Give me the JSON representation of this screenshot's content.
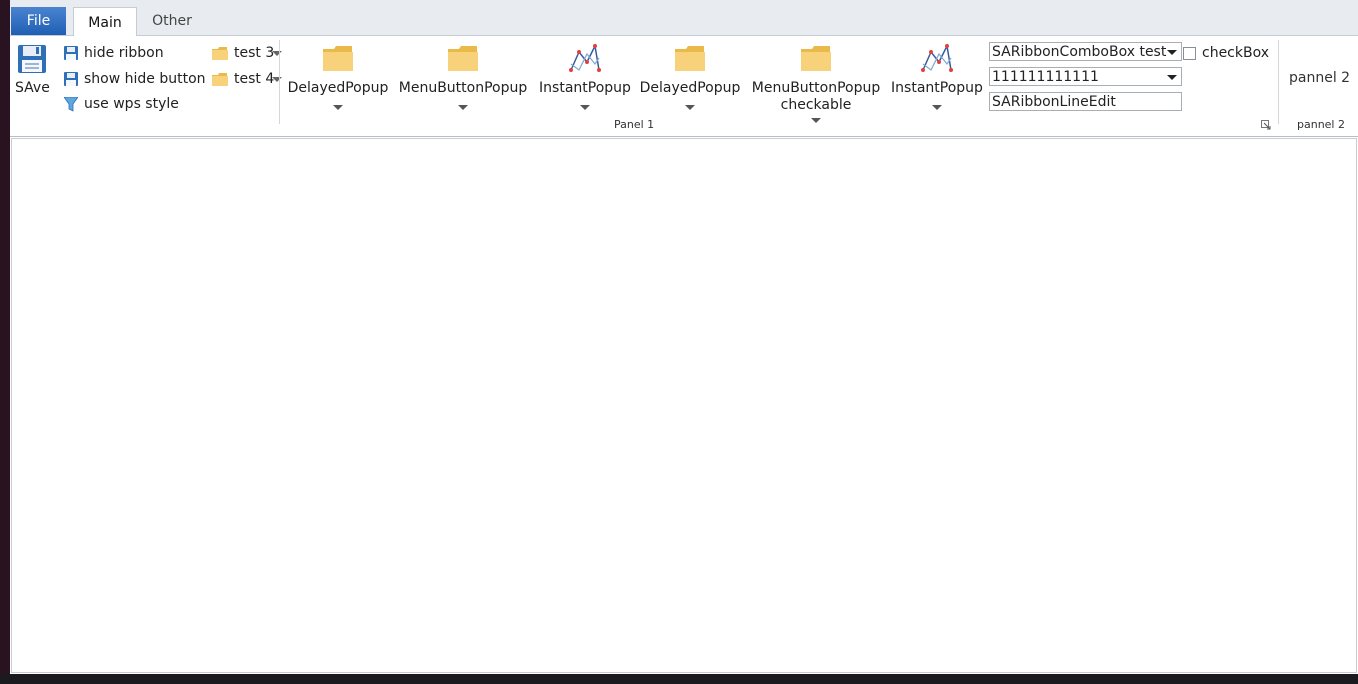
{
  "tabs": {
    "file": "File",
    "main": "Main",
    "other": "Other"
  },
  "quick": {
    "save": "SAve",
    "hide_ribbon": "hide ribbon",
    "show_hide_button": "show hide button",
    "use_wps_style": "use wps style",
    "test3": "test 3",
    "test4": "test 4"
  },
  "panel1": {
    "title": "Panel 1",
    "buttons": [
      {
        "label": "DelayedPopup"
      },
      {
        "label": "MenuButtonPopup"
      },
      {
        "label": "InstantPopup"
      },
      {
        "label": "DelayedPopup"
      },
      {
        "label": "MenuButtonPopup\ncheckable"
      },
      {
        "label": "InstantPopup"
      }
    ],
    "combo1": "SARibbonComboBox test",
    "combo2": "111111111111",
    "line_edit": "SARibbonLineEdit",
    "checkbox": "checkBox"
  },
  "panel2": {
    "title": "pannel 2",
    "button": "pannel 2"
  },
  "colors": {
    "file_tab": "#2a68bf",
    "folder": "#f5c862",
    "chart_line": "#3a5a9c",
    "chart_point": "#e04040"
  }
}
